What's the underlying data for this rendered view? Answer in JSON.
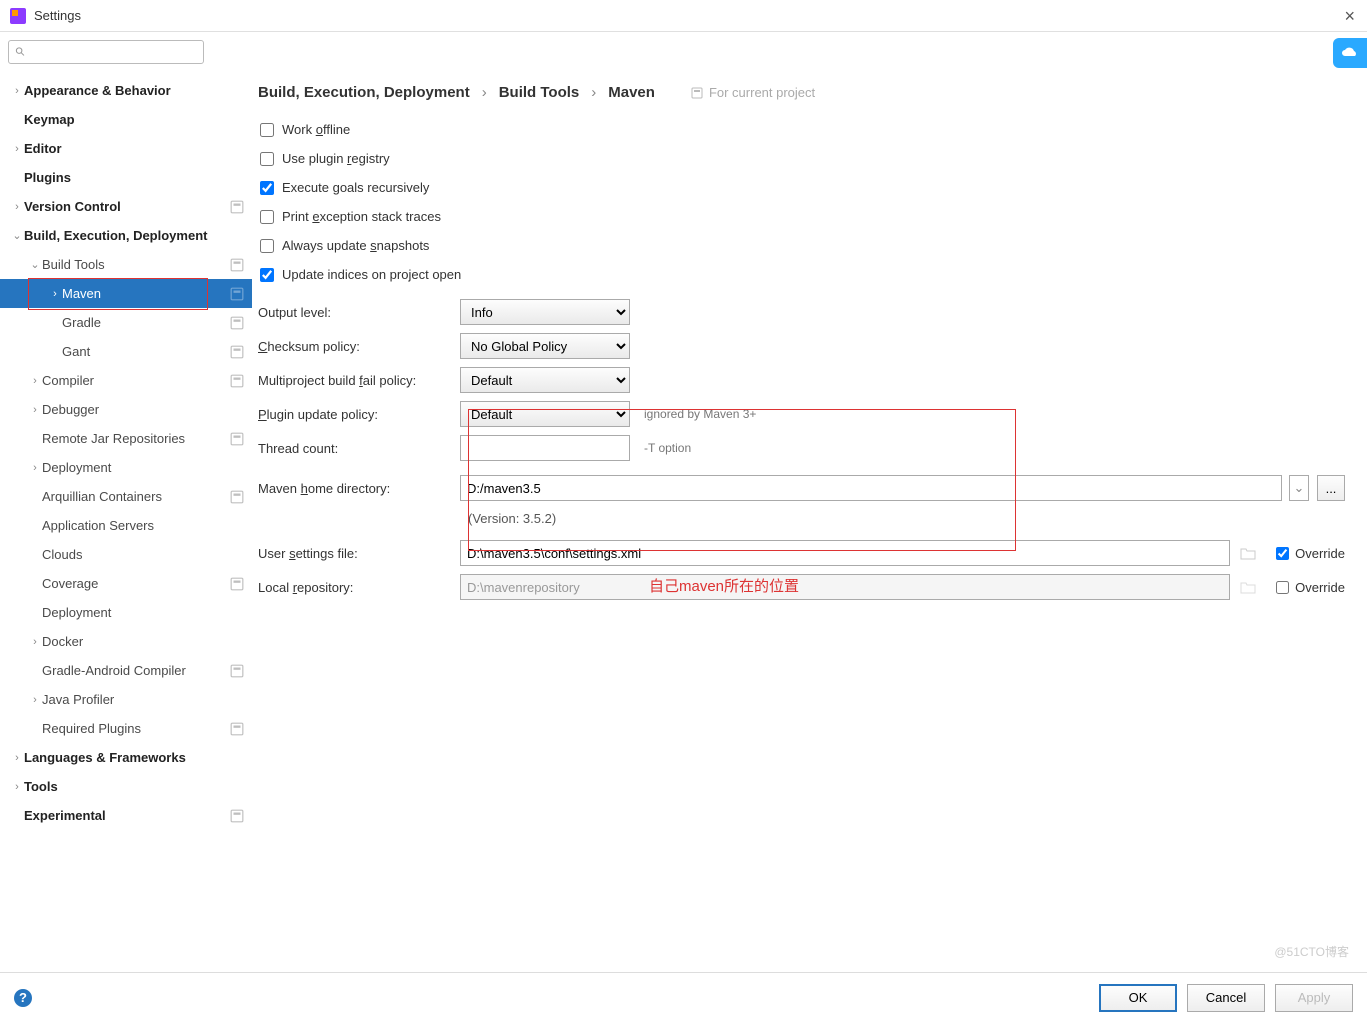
{
  "window": {
    "title": "Settings"
  },
  "search": {
    "placeholder": ""
  },
  "sidebar": {
    "items": [
      {
        "label": "Appearance & Behavior",
        "chev": "›",
        "lvl": 0,
        "bold": true,
        "badge": false
      },
      {
        "label": "Keymap",
        "chev": "",
        "lvl": 0,
        "bold": true,
        "badge": false
      },
      {
        "label": "Editor",
        "chev": "›",
        "lvl": 0,
        "bold": true,
        "badge": false
      },
      {
        "label": "Plugins",
        "chev": "",
        "lvl": 0,
        "bold": true,
        "badge": false
      },
      {
        "label": "Version Control",
        "chev": "›",
        "lvl": 0,
        "bold": true,
        "badge": true
      },
      {
        "label": "Build, Execution, Deployment",
        "chev": "⌄",
        "lvl": 0,
        "bold": true,
        "badge": false
      },
      {
        "label": "Build Tools",
        "chev": "⌄",
        "lvl": 1,
        "bold": false,
        "badge": true
      },
      {
        "label": "Maven",
        "chev": "›",
        "lvl": 2,
        "bold": false,
        "badge": true,
        "selected": true
      },
      {
        "label": "Gradle",
        "chev": "",
        "lvl": 2,
        "bold": false,
        "badge": true
      },
      {
        "label": "Gant",
        "chev": "",
        "lvl": 2,
        "bold": false,
        "badge": true
      },
      {
        "label": "Compiler",
        "chev": "›",
        "lvl": 1,
        "bold": false,
        "badge": true
      },
      {
        "label": "Debugger",
        "chev": "›",
        "lvl": 1,
        "bold": false,
        "badge": false
      },
      {
        "label": "Remote Jar Repositories",
        "chev": "",
        "lvl": 1,
        "bold": false,
        "badge": true
      },
      {
        "label": "Deployment",
        "chev": "›",
        "lvl": 1,
        "bold": false,
        "badge": false
      },
      {
        "label": "Arquillian Containers",
        "chev": "",
        "lvl": 1,
        "bold": false,
        "badge": true
      },
      {
        "label": "Application Servers",
        "chev": "",
        "lvl": 1,
        "bold": false,
        "badge": false
      },
      {
        "label": "Clouds",
        "chev": "",
        "lvl": 1,
        "bold": false,
        "badge": false
      },
      {
        "label": "Coverage",
        "chev": "",
        "lvl": 1,
        "bold": false,
        "badge": true
      },
      {
        "label": "Deployment",
        "chev": "",
        "lvl": 1,
        "bold": false,
        "badge": false
      },
      {
        "label": "Docker",
        "chev": "›",
        "lvl": 1,
        "bold": false,
        "badge": false
      },
      {
        "label": "Gradle-Android Compiler",
        "chev": "",
        "lvl": 1,
        "bold": false,
        "badge": true
      },
      {
        "label": "Java Profiler",
        "chev": "›",
        "lvl": 1,
        "bold": false,
        "badge": false
      },
      {
        "label": "Required Plugins",
        "chev": "",
        "lvl": 1,
        "bold": false,
        "badge": true
      },
      {
        "label": "Languages & Frameworks",
        "chev": "›",
        "lvl": 0,
        "bold": true,
        "badge": false
      },
      {
        "label": "Tools",
        "chev": "›",
        "lvl": 0,
        "bold": true,
        "badge": false
      },
      {
        "label": "Experimental",
        "chev": "",
        "lvl": 0,
        "bold": true,
        "badge": true
      }
    ]
  },
  "breadcrumb": {
    "a": "Build, Execution, Deployment",
    "b": "Build Tools",
    "c": "Maven",
    "note": "For current project"
  },
  "checks": {
    "workOffline": {
      "label": "Work offline",
      "checked": false
    },
    "usePluginRegistry": {
      "label": "Use plugin registry",
      "checked": false
    },
    "executeGoals": {
      "label": "Execute goals recursively",
      "checked": true
    },
    "printException": {
      "label": "Print exception stack traces",
      "checked": false
    },
    "alwaysUpdate": {
      "label": "Always update snapshots",
      "checked": false
    },
    "updateIndices": {
      "label": "Update indices on project open",
      "checked": true
    }
  },
  "form": {
    "outputLevel": {
      "label": "Output level:",
      "value": "Info"
    },
    "checksumPolicy": {
      "label": "Checksum policy:",
      "value": "No Global Policy"
    },
    "multiproject": {
      "label": "Multiproject build fail policy:",
      "value": "Default"
    },
    "pluginUpdate": {
      "label": "Plugin update policy:",
      "value": "Default",
      "hint": "ignored by Maven 3+"
    },
    "threadCount": {
      "label": "Thread count:",
      "value": "",
      "hint": "-T option"
    },
    "mavenHome": {
      "label": "Maven home directory:",
      "value": "D:/maven3.5",
      "version": "(Version: 3.5.2)"
    },
    "userSettings": {
      "label": "User settings file:",
      "value": "D:\\maven3.5\\conf\\settings.xml",
      "override": "Override",
      "overrideChecked": true
    },
    "localRepo": {
      "label": "Local repository:",
      "value": "D:\\mavenrepository",
      "override": "Override",
      "overrideChecked": false
    }
  },
  "annotation": {
    "text": "自己maven所在的位置"
  },
  "footer": {
    "ok": "OK",
    "cancel": "Cancel",
    "apply": "Apply"
  },
  "watermark": "@51CTO博客"
}
